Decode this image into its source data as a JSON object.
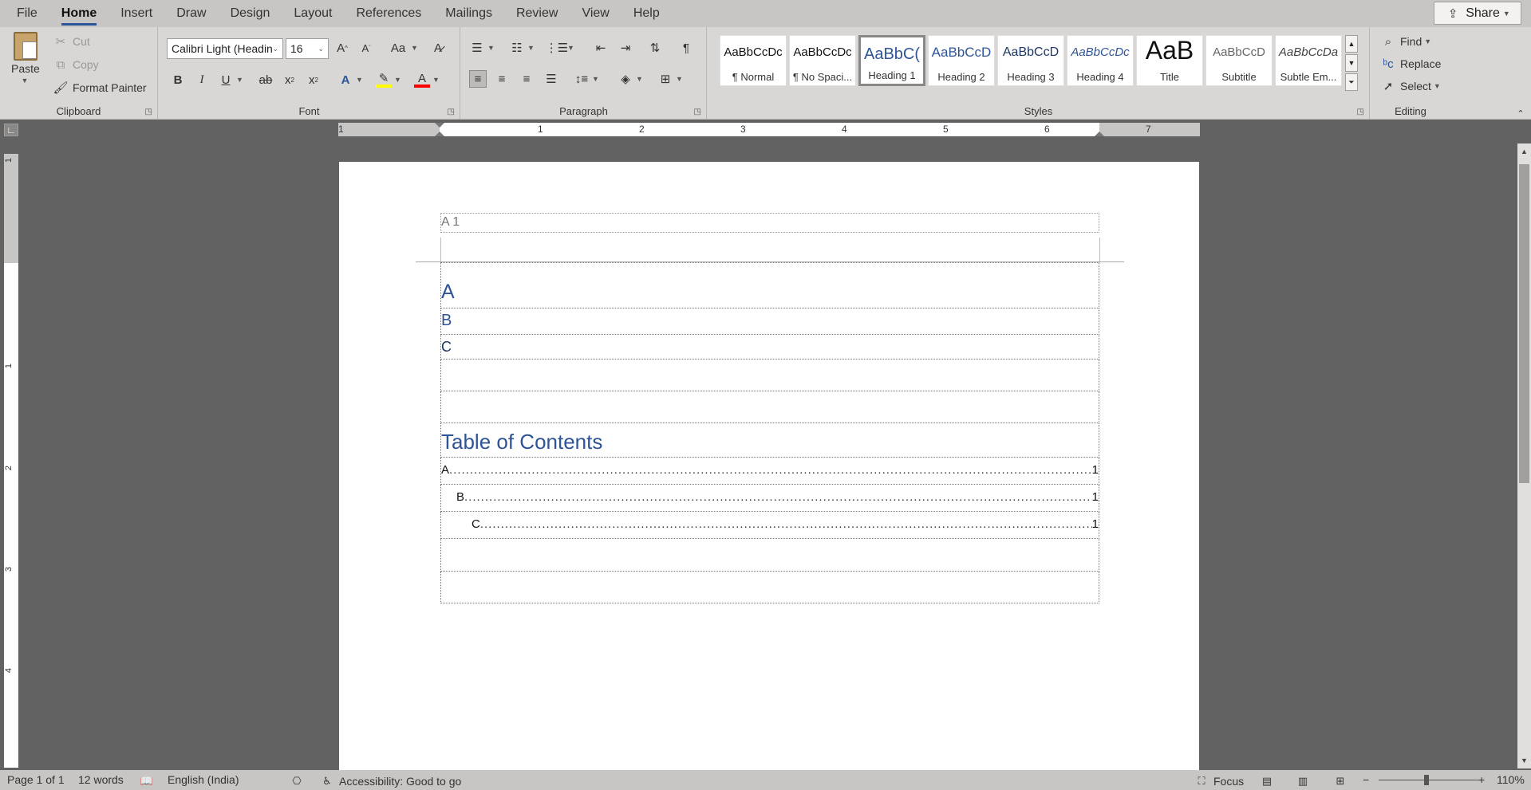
{
  "menu": {
    "tabs": [
      "File",
      "Home",
      "Insert",
      "Draw",
      "Design",
      "Layout",
      "References",
      "Mailings",
      "Review",
      "View",
      "Help"
    ],
    "active_tab": "Home",
    "share_label": "Share"
  },
  "clipboard": {
    "paste_label": "Paste",
    "cut_label": "Cut",
    "copy_label": "Copy",
    "format_painter_label": "Format Painter",
    "group_label": "Clipboard"
  },
  "font": {
    "family": "Calibri Light (Headin",
    "size": "16",
    "group_label": "Font",
    "highlight_color": "#ffff00",
    "font_color": "#ff0000"
  },
  "paragraph": {
    "group_label": "Paragraph"
  },
  "styles": {
    "group_label": "Styles",
    "items": [
      {
        "preview": "AaBbCcDc",
        "name": "¶ Normal"
      },
      {
        "preview": "AaBbCcDc",
        "name": "¶ No Spaci..."
      },
      {
        "preview": "AaBbC(",
        "name": "Heading 1"
      },
      {
        "preview": "AaBbCcD",
        "name": "Heading 2"
      },
      {
        "preview": "AaBbCcD",
        "name": "Heading 3"
      },
      {
        "preview": "AaBbCcDc",
        "name": "Heading 4"
      },
      {
        "preview": "AaB",
        "name": "Title"
      },
      {
        "preview": "AaBbCcD",
        "name": "Subtitle"
      },
      {
        "preview": "AaBbCcDa",
        "name": "Subtle Em..."
      }
    ]
  },
  "editing": {
    "group_label": "Editing",
    "find_label": "Find",
    "replace_label": "Replace",
    "select_label": "Select"
  },
  "ruler": {
    "numbers": [
      "1",
      "1",
      "2",
      "3",
      "4",
      "5",
      "6",
      "7"
    ]
  },
  "vruler": {
    "numbers": [
      "1",
      "1",
      "2",
      "3",
      "4"
    ]
  },
  "document": {
    "header_text": "A 1",
    "headings": [
      "A",
      "B",
      "C"
    ],
    "toc_title": "Table of Contents",
    "toc_entries": [
      {
        "label": "A",
        "page": "1"
      },
      {
        "label": "B",
        "page": "1"
      },
      {
        "label": "C",
        "page": "1"
      }
    ]
  },
  "status": {
    "page": "Page 1 of 1",
    "words": "12 words",
    "language": "English (India)",
    "accessibility": "Accessibility: Good to go",
    "focus_label": "Focus",
    "zoom": "110%"
  },
  "colors": {
    "accent": "#2b579a",
    "heading": "#2f5496"
  }
}
